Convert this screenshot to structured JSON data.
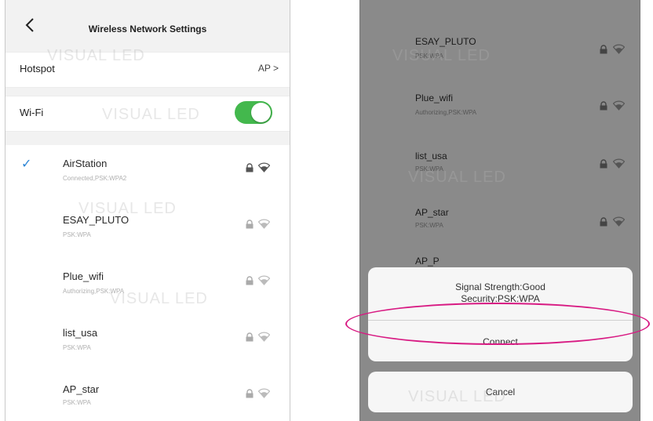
{
  "left": {
    "header": {
      "title": "Wireless Network Settings"
    },
    "hotspot": {
      "label": "Hotspot",
      "value": "AP >"
    },
    "wifi": {
      "label": "Wi-Fi",
      "enabled": true
    },
    "networks": [
      {
        "name": "AirStation",
        "status": "Connected,PSK:WPA2",
        "connected": true
      },
      {
        "name": "ESAY_PLUTO",
        "status": "PSK:WPA",
        "connected": false
      },
      {
        "name": "Plue_wifi",
        "status": "Authorizing,PSK:WPA",
        "connected": false
      },
      {
        "name": "list_usa",
        "status": "PSK:WPA",
        "connected": false
      },
      {
        "name": "AP_star",
        "status": "PSK:WPA",
        "connected": false
      }
    ]
  },
  "right": {
    "networks": [
      {
        "name": "ESAY_PLUTO",
        "status": "PSK:WPA"
      },
      {
        "name": "Plue_wifi",
        "status": "Authorizing,PSK:WPA"
      },
      {
        "name": "list_usa",
        "status": "PSK:WPA"
      },
      {
        "name": "AP_star",
        "status": "PSK:WPA"
      }
    ],
    "partial_network": "AP_P",
    "dialog": {
      "signal": "Signal Strength:Good",
      "security": "Security:PSK:WPA",
      "connect": "Connect",
      "cancel": "Cancel"
    }
  },
  "watermark": "VISUAL LED",
  "colors": {
    "toggle_on": "#43b84d",
    "check": "#2d86d6",
    "highlight": "#d81b83"
  },
  "icons": [
    "back-arrow-icon",
    "check-icon",
    "lock-icon",
    "wifi-icon",
    "logo-icon"
  ]
}
